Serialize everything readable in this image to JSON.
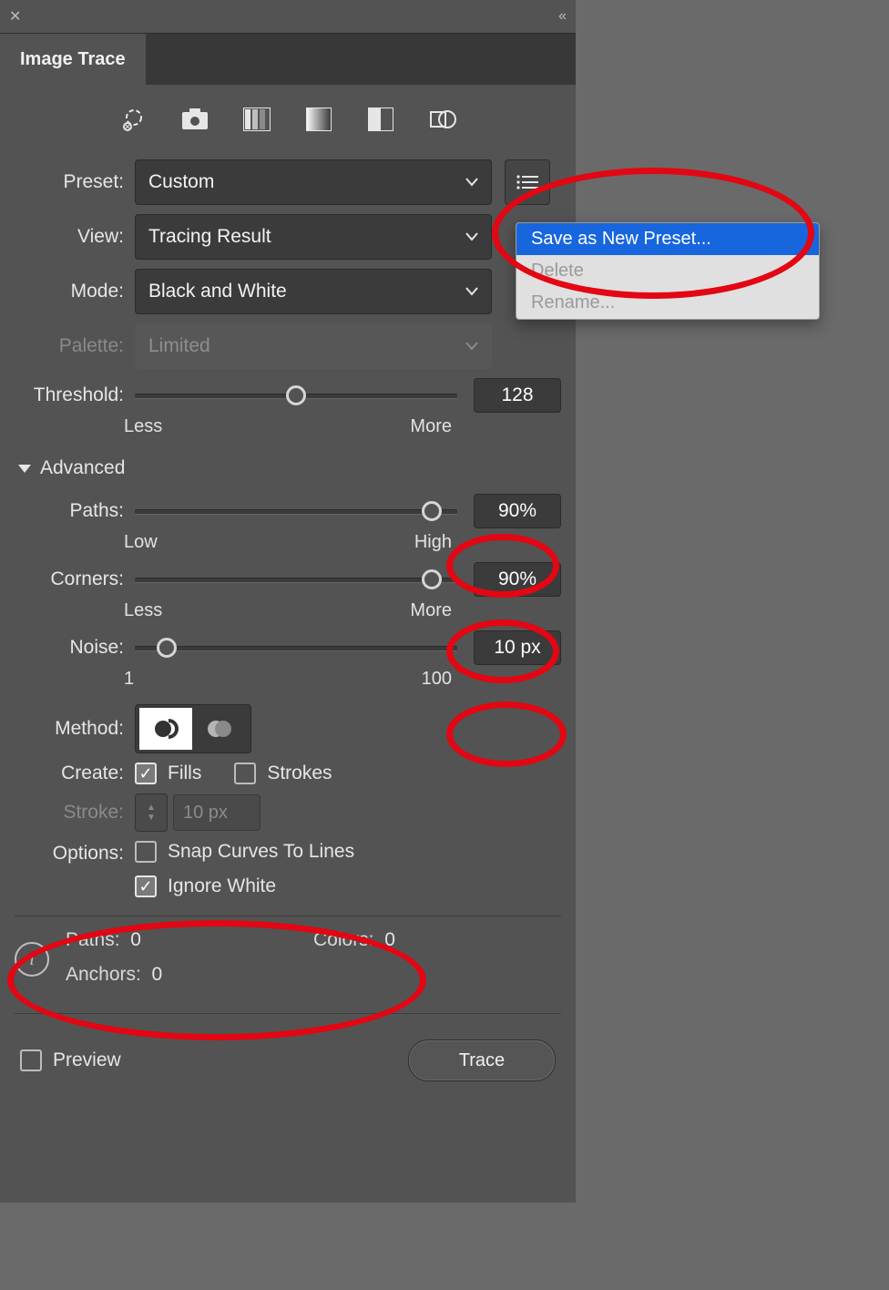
{
  "panel": {
    "title": "Image Trace",
    "close_glyph": "✕",
    "collapse_glyph": "«"
  },
  "icons": [
    "auto-color",
    "photo",
    "shades",
    "gradient",
    "bw",
    "outline"
  ],
  "preset": {
    "label": "Preset:",
    "value": "Custom",
    "has_menu": true
  },
  "view": {
    "label": "View:",
    "value": "Tracing Result"
  },
  "mode": {
    "label": "Mode:",
    "value": "Black and White"
  },
  "palette": {
    "label": "Palette:",
    "value": "Limited",
    "disabled": true
  },
  "threshold": {
    "label": "Threshold:",
    "value": "128",
    "min_label": "Less",
    "max_label": "More",
    "pos": 50
  },
  "advanced": {
    "label": "Advanced"
  },
  "paths": {
    "label": "Paths:",
    "value": "90%",
    "min_label": "Low",
    "max_label": "High",
    "pos": 90
  },
  "corners": {
    "label": "Corners:",
    "value": "90%",
    "min_label": "Less",
    "max_label": "More",
    "pos": 90
  },
  "noise": {
    "label": "Noise:",
    "value": "10 px",
    "min_label": "1",
    "max_label": "100",
    "pos": 10
  },
  "method": {
    "label": "Method:"
  },
  "create": {
    "label": "Create:",
    "fills_label": "Fills",
    "strokes_label": "Strokes",
    "fills": true,
    "strokes": false
  },
  "stroke": {
    "label": "Stroke:",
    "value": "10 px",
    "disabled": true
  },
  "options": {
    "label": "Options:",
    "snap_label": "Snap Curves To Lines",
    "ignore_label": "Ignore White",
    "snap": false,
    "ignore": true
  },
  "info": {
    "paths_label": "Paths:",
    "paths_value": "0",
    "colors_label": "Colors:",
    "colors_value": "0",
    "anchors_label": "Anchors:",
    "anchors_value": "0"
  },
  "footer": {
    "preview_label": "Preview",
    "trace_label": "Trace"
  },
  "popup": {
    "save": "Save as New Preset...",
    "delete": "Delete",
    "rename": "Rename..."
  }
}
